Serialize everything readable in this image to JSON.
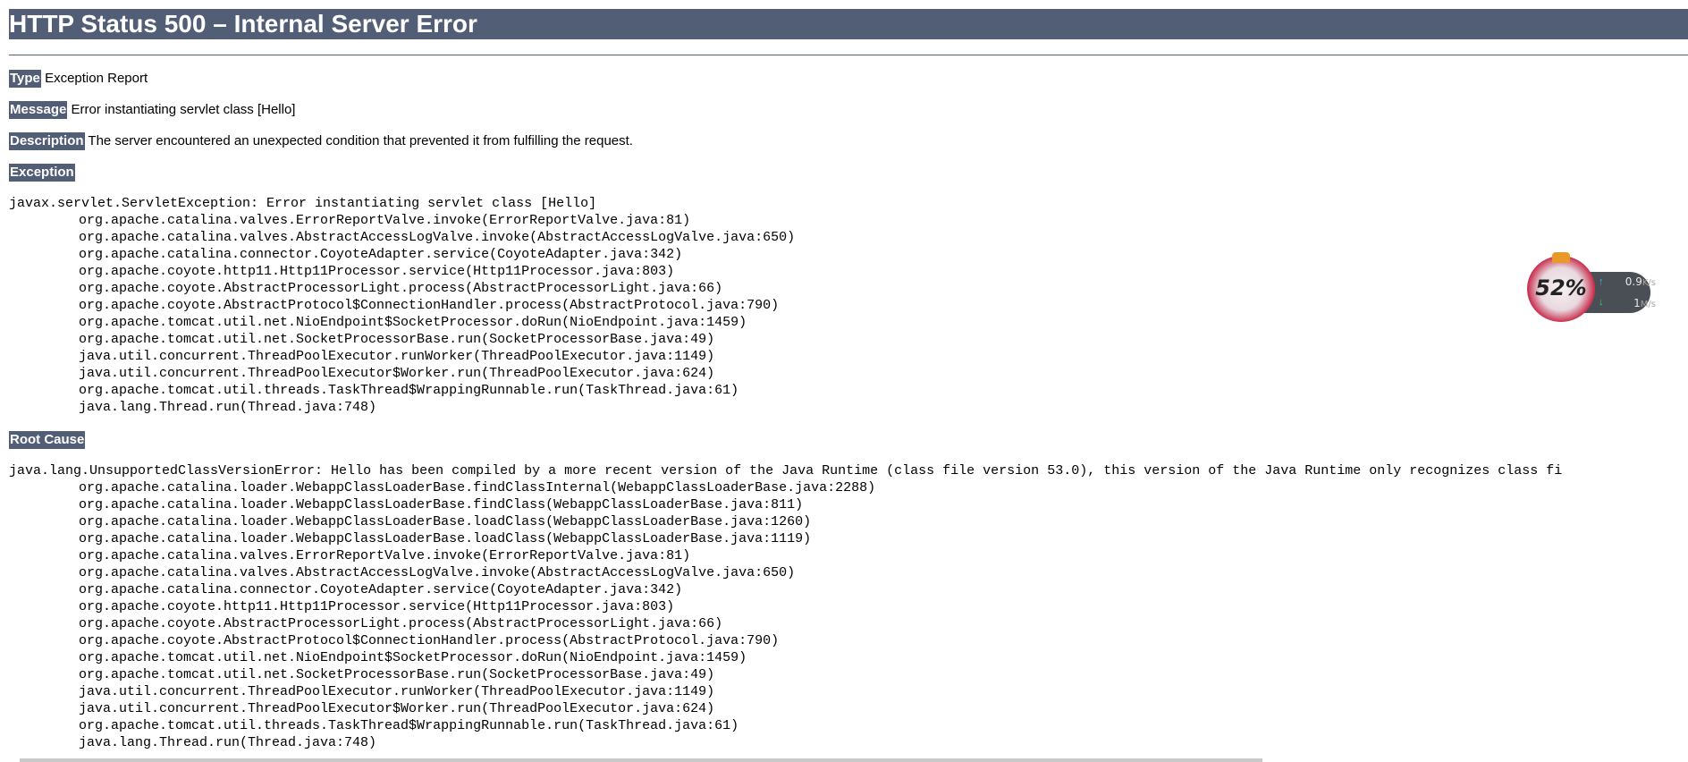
{
  "title": "HTTP Status 500 – Internal Server Error",
  "type": {
    "label": "Type",
    "value": "Exception Report"
  },
  "message": {
    "label": "Message",
    "value": "Error instantiating servlet class [Hello]"
  },
  "description": {
    "label": "Description",
    "value": "The server encountered an unexpected condition that prevented it from fulfilling the request."
  },
  "exception": {
    "label": "Exception",
    "head": "javax.servlet.ServletException: Error instantiating servlet class [Hello]",
    "frames": [
      "org.apache.catalina.valves.ErrorReportValve.invoke(ErrorReportValve.java:81)",
      "org.apache.catalina.valves.AbstractAccessLogValve.invoke(AbstractAccessLogValve.java:650)",
      "org.apache.catalina.connector.CoyoteAdapter.service(CoyoteAdapter.java:342)",
      "org.apache.coyote.http11.Http11Processor.service(Http11Processor.java:803)",
      "org.apache.coyote.AbstractProcessorLight.process(AbstractProcessorLight.java:66)",
      "org.apache.coyote.AbstractProtocol$ConnectionHandler.process(AbstractProtocol.java:790)",
      "org.apache.tomcat.util.net.NioEndpoint$SocketProcessor.doRun(NioEndpoint.java:1459)",
      "org.apache.tomcat.util.net.SocketProcessorBase.run(SocketProcessorBase.java:49)",
      "java.util.concurrent.ThreadPoolExecutor.runWorker(ThreadPoolExecutor.java:1149)",
      "java.util.concurrent.ThreadPoolExecutor$Worker.run(ThreadPoolExecutor.java:624)",
      "org.apache.tomcat.util.threads.TaskThread$WrappingRunnable.run(TaskThread.java:61)",
      "java.lang.Thread.run(Thread.java:748)"
    ]
  },
  "root_cause": {
    "label": "Root Cause",
    "head": "java.lang.UnsupportedClassVersionError: Hello has been compiled by a more recent version of the Java Runtime (class file version 53.0), this version of the Java Runtime only recognizes class fi",
    "frames": [
      "org.apache.catalina.loader.WebappClassLoaderBase.findClassInternal(WebappClassLoaderBase.java:2288)",
      "org.apache.catalina.loader.WebappClassLoaderBase.findClass(WebappClassLoaderBase.java:811)",
      "org.apache.catalina.loader.WebappClassLoaderBase.loadClass(WebappClassLoaderBase.java:1260)",
      "org.apache.catalina.loader.WebappClassLoaderBase.loadClass(WebappClassLoaderBase.java:1119)",
      "org.apache.catalina.valves.ErrorReportValve.invoke(ErrorReportValve.java:81)",
      "org.apache.catalina.valves.AbstractAccessLogValve.invoke(AbstractAccessLogValve.java:650)",
      "org.apache.catalina.connector.CoyoteAdapter.service(CoyoteAdapter.java:342)",
      "org.apache.coyote.http11.Http11Processor.service(Http11Processor.java:803)",
      "org.apache.coyote.AbstractProcessorLight.process(AbstractProcessorLight.java:66)",
      "org.apache.coyote.AbstractProtocol$ConnectionHandler.process(AbstractProtocol.java:790)",
      "org.apache.tomcat.util.net.NioEndpoint$SocketProcessor.doRun(NioEndpoint.java:1459)",
      "org.apache.tomcat.util.net.SocketProcessorBase.run(SocketProcessorBase.java:49)",
      "java.util.concurrent.ThreadPoolExecutor.runWorker(ThreadPoolExecutor.java:1149)",
      "java.util.concurrent.ThreadPoolExecutor$Worker.run(ThreadPoolExecutor.java:624)",
      "org.apache.tomcat.util.threads.TaskThread$WrappingRunnable.run(TaskThread.java:61)",
      "java.lang.Thread.run(Thread.java:748)"
    ]
  },
  "net_meter": {
    "percent": "52%",
    "upload": "0.9",
    "upload_unit": "K/s",
    "download": "1",
    "download_unit": "M/s"
  },
  "colors": {
    "header_bg": "#525d76",
    "header_text": "#ffffff"
  }
}
